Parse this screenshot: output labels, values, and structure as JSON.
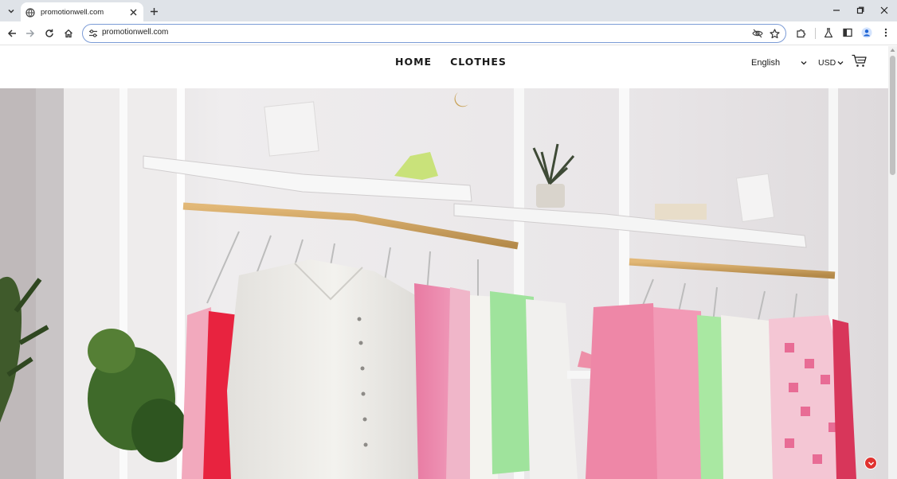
{
  "browser": {
    "tab": {
      "title": "promotionwell.com"
    },
    "address_bar": {
      "url": "promotionwell.com"
    }
  },
  "site": {
    "nav": [
      {
        "label": "HOME"
      },
      {
        "label": "CLOTHES"
      }
    ],
    "language": "English",
    "currency": "USD"
  },
  "colors": {
    "accent_badge": "#e0322f",
    "omnibox_border": "#7b9bd6",
    "tabstrip": "#dfe3e8"
  },
  "icons": {
    "tab_list": "chevron-down-icon",
    "favicon": "globe-icon",
    "tab_close": "close-icon",
    "new_tab": "plus-icon",
    "back": "arrow-left-icon",
    "forward": "arrow-right-icon",
    "reload": "reload-icon",
    "home": "home-icon",
    "site_info": "tune-icon",
    "tracking": "eye-off-icon",
    "bookmark": "star-icon",
    "extensions": "puzzle-icon",
    "labs": "flask-icon",
    "side_panel": "side-panel-icon",
    "profile": "avatar-icon",
    "menu": "kebab-menu-icon",
    "cart": "cart-icon",
    "chat": "chat-icon"
  }
}
